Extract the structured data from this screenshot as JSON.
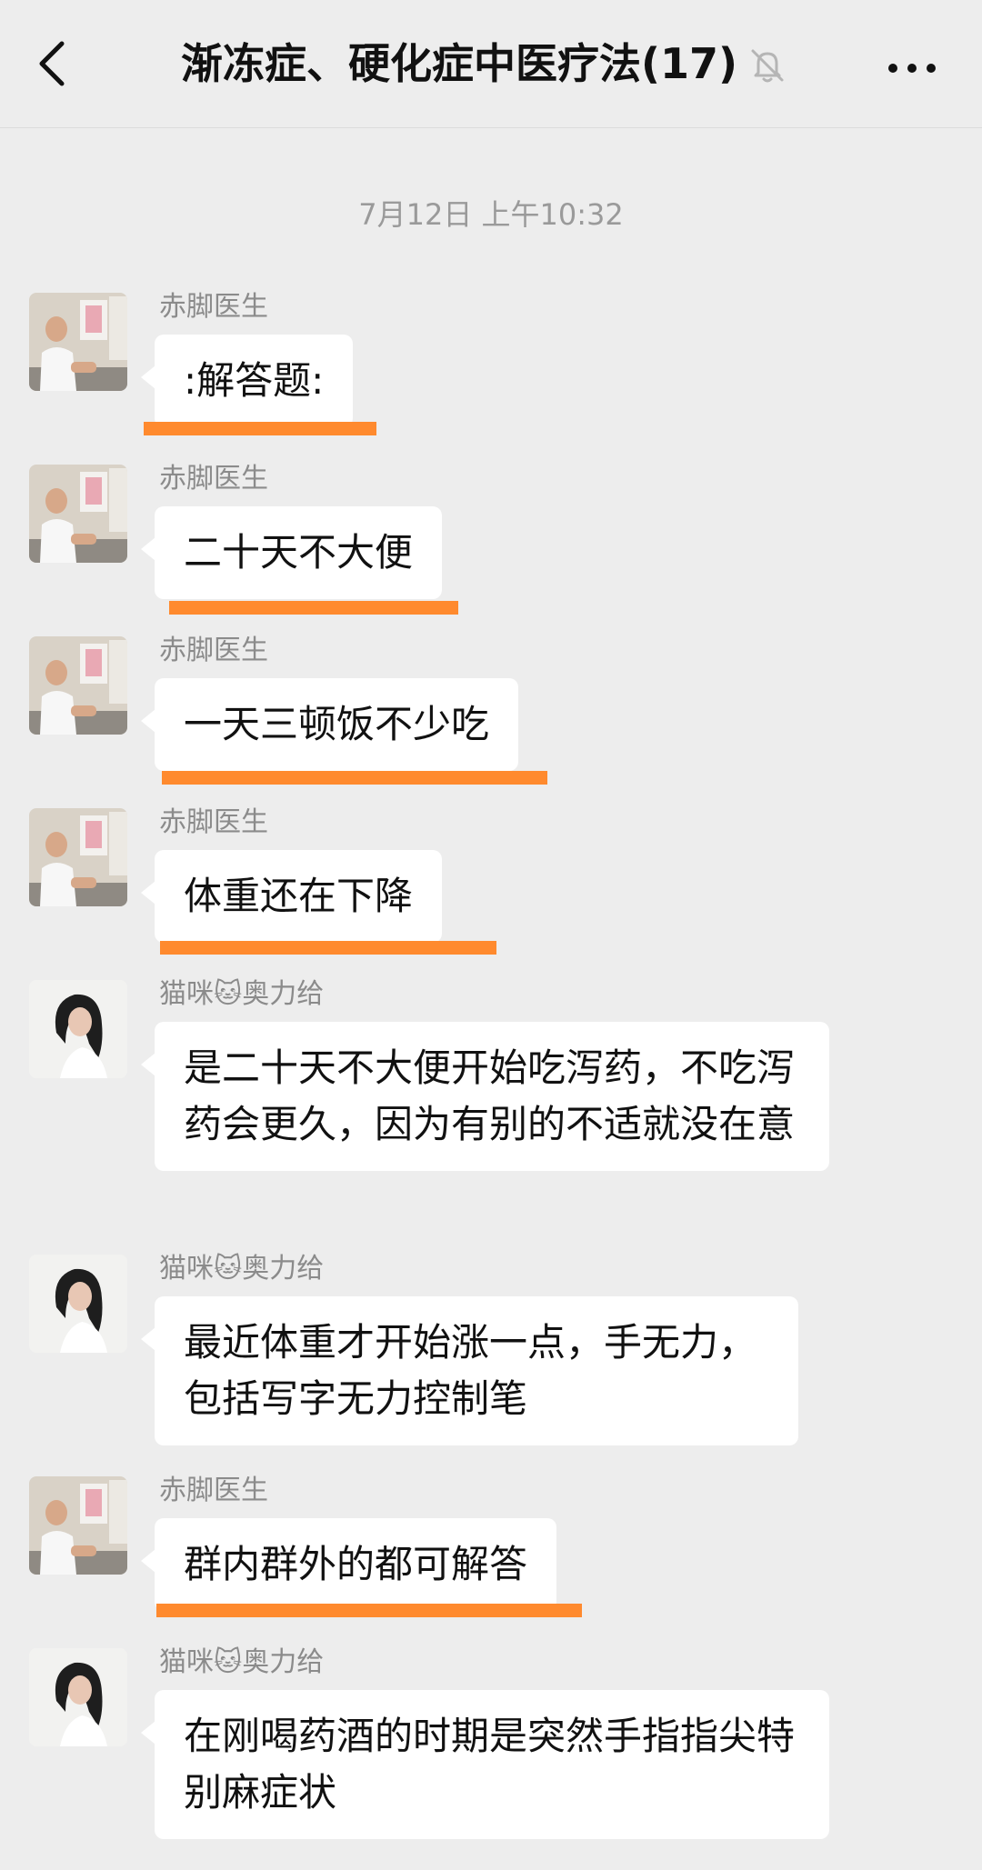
{
  "header": {
    "title": "渐冻症、硬化症中医疗法(17)",
    "back_icon": "chevron-left-icon",
    "mute_icon": "bell-muted-icon",
    "more_icon": "more-dots-icon"
  },
  "timestamp": "7月12日 上午10:32",
  "colors": {
    "background": "#ededed",
    "bubble": "#ffffff",
    "highlight_underline": "#ff8a2e",
    "sender_name": "#8b8b8b",
    "timestamp": "#9a9a9a"
  },
  "messages": [
    {
      "sender": "赤脚医生",
      "text": ":解答题:",
      "underlined": true
    },
    {
      "sender": "赤脚医生",
      "text": "二十天不大便",
      "underlined": true
    },
    {
      "sender": "赤脚医生",
      "text": "一天三顿饭不少吃",
      "underlined": true
    },
    {
      "sender": "赤脚医生",
      "text": "体重还在下降",
      "underlined": true
    },
    {
      "sender": "猫咪🐱奥力给",
      "text": "是二十天不大便开始吃泻药，不吃泻药会更久，因为有别的不适就没在意",
      "underlined": false
    },
    {
      "sender": "猫咪🐱奥力给",
      "text": "最近体重才开始涨一点，手无力，包括写字无力控制笔",
      "underlined": false
    },
    {
      "sender": "赤脚医生",
      "text": "群内群外的都可解答",
      "underlined": true
    },
    {
      "sender": "猫咪🐱奥力给",
      "text": "在刚喝药酒的时期是突然手指指尖特别麻症状",
      "underlined": false
    }
  ]
}
